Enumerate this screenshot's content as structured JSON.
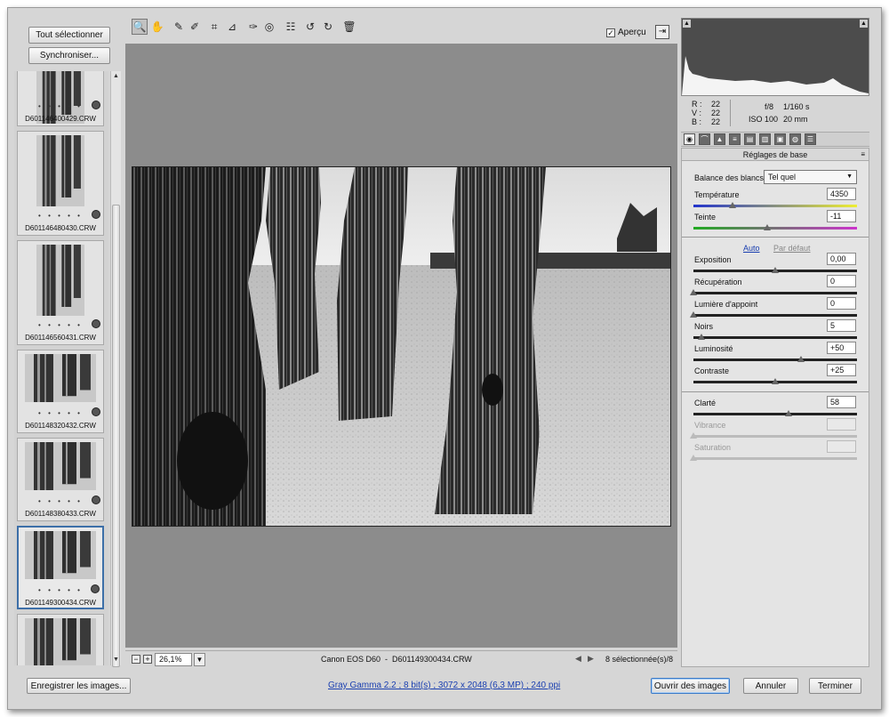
{
  "buttons": {
    "select_all": "Tout sélectionner",
    "synchronize": "Synchroniser...",
    "save_images": "Enregistrer les images...",
    "open_images": "Ouvrir des images",
    "cancel": "Annuler",
    "done": "Terminer"
  },
  "filmstrip": [
    {
      "name": "D601146400429.CRW",
      "dots": "• • • • •",
      "orientation": "portrait",
      "selected": false
    },
    {
      "name": "D601146480430.CRW",
      "dots": "• • • • •",
      "orientation": "portrait",
      "selected": false
    },
    {
      "name": "D601146560431.CRW",
      "dots": "• • • • •",
      "orientation": "portrait",
      "selected": false
    },
    {
      "name": "D601148320432.CRW",
      "dots": "• • • • •",
      "orientation": "landscape",
      "selected": false
    },
    {
      "name": "D601148380433.CRW",
      "dots": "• • • • •",
      "orientation": "landscape",
      "selected": false
    },
    {
      "name": "D601149300434.CRW",
      "dots": "• • • • •",
      "orientation": "landscape",
      "selected": true
    },
    {
      "name": "",
      "dots": "",
      "orientation": "landscape",
      "selected": false
    }
  ],
  "toolbar": {
    "tools": [
      "zoom-icon",
      "hand-icon",
      "white-balance-icon",
      "color-sampler-icon",
      "crop-icon",
      "straighten-icon",
      "retouch-icon",
      "red-eye-icon",
      "preferences-icon",
      "rotate-left-icon",
      "rotate-right-icon",
      "trash-icon"
    ],
    "preview_label": "Aperçu",
    "preview_checked": true
  },
  "status": {
    "zoom": "26,1%",
    "camera": "Canon EOS D60",
    "filename": "D601149300434.CRW",
    "selection": "8 sélectionnée(s)/8"
  },
  "readout": {
    "r_label": "R :",
    "r": "22",
    "v_label": "V :",
    "v": "22",
    "b_label": "B :",
    "b": "22",
    "aperture": "f/8",
    "shutter": "1/160 s",
    "iso": "ISO 100",
    "focal": "20 mm"
  },
  "panel": {
    "title": "Réglages de base",
    "wb_label": "Balance des blancs :",
    "wb_value": "Tel quel",
    "auto": "Auto",
    "default": "Par défaut",
    "sliders": [
      {
        "key": "temperature",
        "label": "Température",
        "value": "4350",
        "level": 0.24,
        "disabled": false,
        "track": "temp"
      },
      {
        "key": "tint",
        "label": "Teinte",
        "value": "-11",
        "level": 0.45,
        "disabled": false,
        "track": "tint"
      },
      {
        "key": "exposure",
        "label": "Exposition",
        "value": "0,00",
        "level": 0.5,
        "disabled": false,
        "track": "dark"
      },
      {
        "key": "recovery",
        "label": "Récupération",
        "value": "0",
        "level": 0.0,
        "disabled": false,
        "track": "dark"
      },
      {
        "key": "fill",
        "label": "Lumière d'appoint",
        "value": "0",
        "level": 0.0,
        "disabled": false,
        "track": "dark"
      },
      {
        "key": "blacks",
        "label": "Noirs",
        "value": "5",
        "level": 0.05,
        "disabled": false,
        "track": "dark"
      },
      {
        "key": "brightness",
        "label": "Luminosité",
        "value": "+50",
        "level": 0.66,
        "disabled": false,
        "track": "dark"
      },
      {
        "key": "contrast",
        "label": "Contraste",
        "value": "+25",
        "level": 0.5,
        "disabled": false,
        "track": "dark"
      },
      {
        "key": "clarity",
        "label": "Clarté",
        "value": "58",
        "level": 0.58,
        "disabled": false,
        "track": "dark"
      },
      {
        "key": "vibrance",
        "label": "Vibrance",
        "value": "",
        "level": 0.0,
        "disabled": true,
        "track": "dis"
      },
      {
        "key": "saturation",
        "label": "Saturation",
        "value": "",
        "level": 0.0,
        "disabled": true,
        "track": "dis"
      }
    ]
  },
  "footer_info": "Gray Gamma 2.2 ; 8 bit(s) ; 3072 x 2048 (6,3 MP) ; 240 ppi",
  "colors": {
    "accent": "#3d6fa8",
    "link": "#1a3fb0"
  }
}
